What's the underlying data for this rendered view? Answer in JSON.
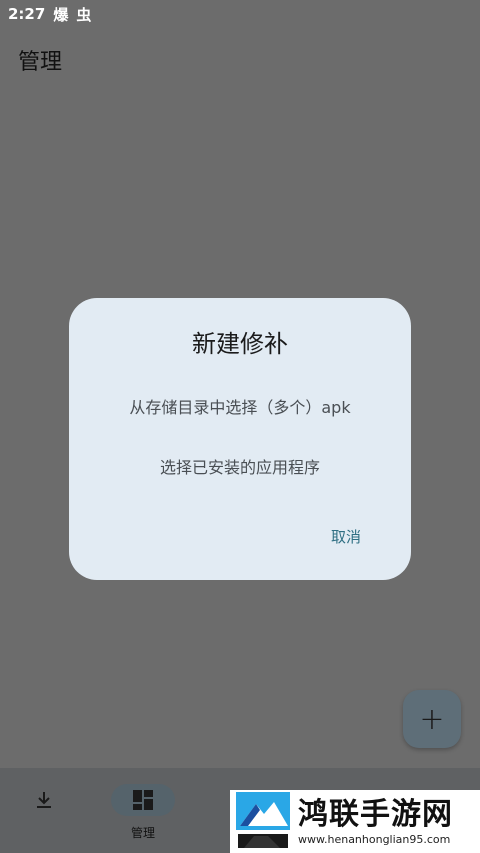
{
  "status_bar": {
    "time": "2:27",
    "icon1": "爆",
    "icon2": "虫"
  },
  "app_bar": {
    "title": "管理"
  },
  "dialog": {
    "title": "新建修补",
    "option_storage": "从存储目录中选择（多个）apk",
    "option_installed": "选择已安装的应用程序",
    "cancel": "取消"
  },
  "fab": {
    "icon": "plus-icon",
    "symbol": "+"
  },
  "bottom_nav": {
    "items": [
      {
        "label": "",
        "icon": "download-icon"
      },
      {
        "label": "管理",
        "icon": "dashboard-icon",
        "active": true
      }
    ]
  },
  "watermark": {
    "title": "鸿联手游网",
    "url": "www.henanhonglian95.com"
  },
  "colors": {
    "scrim": "#6c6c6c",
    "dialog_bg": "#e2ebf3",
    "accent": "#2f6f83"
  }
}
